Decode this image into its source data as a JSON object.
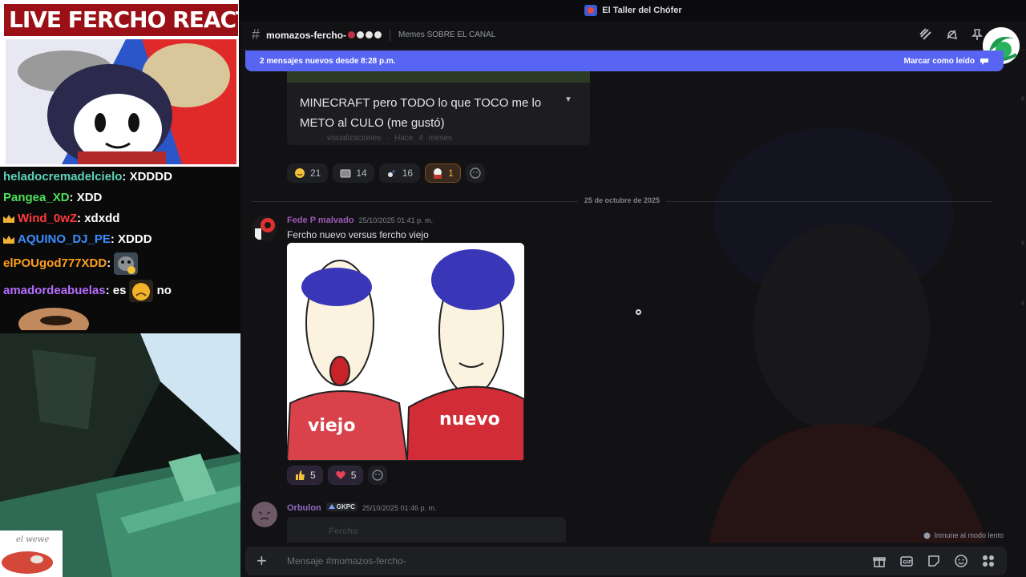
{
  "overlay": {
    "live_title": "LIVE FERCHO REACTION",
    "chat": [
      {
        "user": "heladocremadelcielo",
        "text": "XDDDD",
        "color": "#5fd3b8",
        "crown": false
      },
      {
        "user": "Pangea_XD",
        "text": "XDD",
        "color": "#4ee05a",
        "crown": false
      },
      {
        "user": "Wind_0wZ",
        "text": "xdxdd",
        "color": "#ff3b3b",
        "crown": true
      },
      {
        "user": "AQUINO_DJ_PE",
        "text": "XDDD",
        "color": "#3b8cff",
        "crown": true
      },
      {
        "user": "elPOUgod777XDD",
        "text": "",
        "color": "#ff9e1f",
        "crown": false
      },
      {
        "user": "amadordeabuelas",
        "text": "es",
        "text_after": "no",
        "color": "#b56cff",
        "crown": false
      }
    ],
    "cam_label": "el wewe"
  },
  "discord": {
    "window_title": "El Taller del Chófer",
    "channel": {
      "name": "momazos-fercho-",
      "topic": "Memes SOBRE EL CANAL"
    },
    "new_messages_bar": {
      "text": "2 mensajes nuevos desde 8:28 p.m.",
      "action": "Marcar como leído"
    },
    "youtube_embed": {
      "title": "MINECRAFT pero TODO lo que TOCO me lo METO al CULO (me gustó)",
      "meta": "visualizaciones · Hace 4 meses"
    },
    "reactions_1": [
      {
        "emoji": "grin",
        "count": "21",
        "highlighted": false,
        "mine": false
      },
      {
        "emoji": "tv",
        "count": "14",
        "highlighted": false,
        "mine": false
      },
      {
        "emoji": "sparkle",
        "count": "16",
        "highlighted": false,
        "mine": false
      },
      {
        "emoji": "fercho",
        "count": "1",
        "highlighted": true,
        "mine": false
      }
    ],
    "date_divider": "25 de octubre de 2025",
    "message_fede": {
      "author": "Fede P malvado",
      "author_color": "#9b59b6",
      "timestamp": "25/10/2025 01:41 p. m.",
      "text": "Fercho nuevo versus fercho viejo",
      "meme_labels": {
        "left": "viejo",
        "right": "nuevo"
      }
    },
    "reactions_2": [
      {
        "emoji": "thumbs-up",
        "count": "5",
        "mine": true
      },
      {
        "emoji": "sparkling-heart",
        "count": "5",
        "mine": true
      }
    ],
    "message_orbulon": {
      "author": "Orbulon",
      "author_color": "#8e6cc8",
      "guild_tag": "GKPC",
      "timestamp": "25/10/2025 01:46 p. m.",
      "embed_text": "Fercho"
    },
    "slowmode_text": "Inmune al modo lento",
    "composer_placeholder": "Mensaje #momazos-fercho-"
  }
}
